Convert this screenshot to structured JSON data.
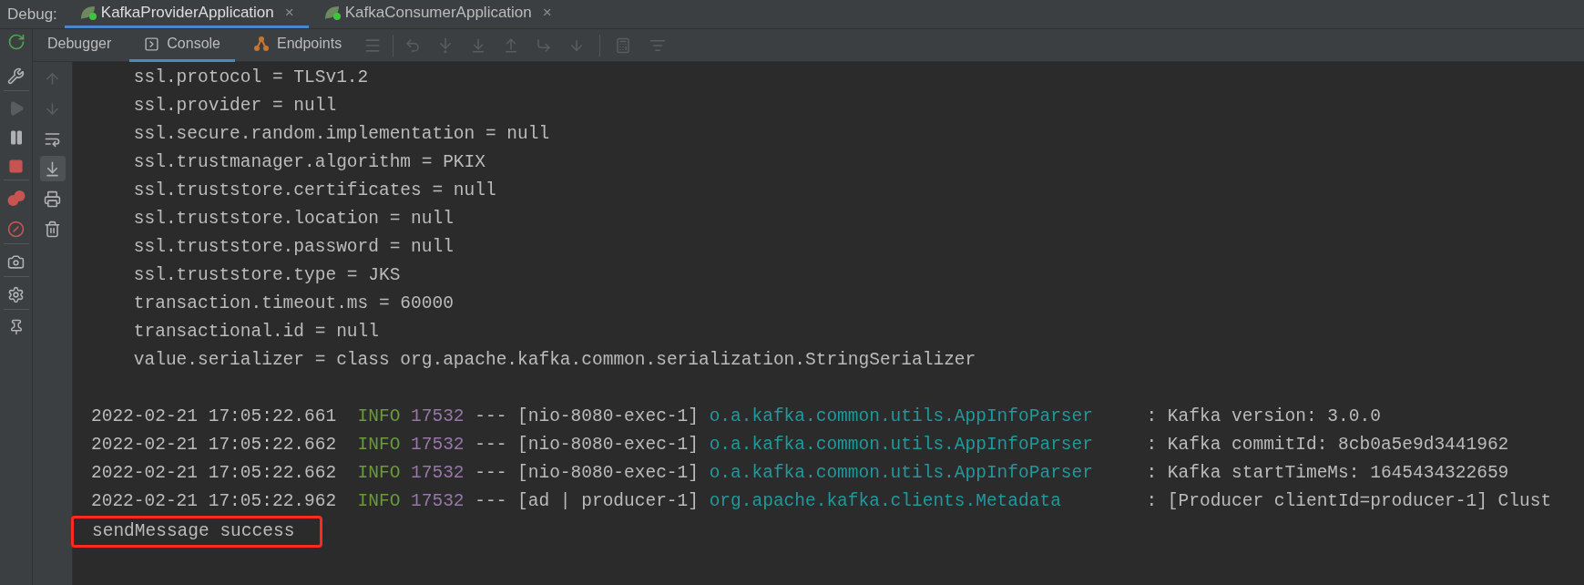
{
  "debug_label": "Debug:",
  "run_tabs": [
    {
      "label": "KafkaProviderApplication",
      "selected": true,
      "close": "×"
    },
    {
      "label": "KafkaConsumerApplication",
      "selected": false,
      "close": "×"
    }
  ],
  "toolbar_tabs": [
    {
      "label": "Debugger",
      "selected": false,
      "kind": "plain"
    },
    {
      "label": "Console",
      "selected": true,
      "kind": "console"
    },
    {
      "label": "Endpoints",
      "selected": false,
      "kind": "endpoints"
    }
  ],
  "scroll_to_end": {
    "on": true
  },
  "config_lines": [
    "ssl.protocol = TLSv1.2",
    "ssl.provider = null",
    "ssl.secure.random.implementation = null",
    "ssl.trustmanager.algorithm = PKIX",
    "ssl.truststore.certificates = null",
    "ssl.truststore.location = null",
    "ssl.truststore.password = null",
    "ssl.truststore.type = JKS",
    "transaction.timeout.ms = 60000",
    "transactional.id = null",
    "value.serializer = class org.apache.kafka.common.serialization.StringSerializer"
  ],
  "log_lines": [
    {
      "timestamp": "2022-02-21 17:05:22.661",
      "level": "INFO",
      "pid": "17532",
      "separator": "---",
      "thread": "[nio-8080-exec-1]",
      "logger": "o.a.kafka.common.utils.AppInfoParser",
      "message": ": Kafka version: 3.0.0"
    },
    {
      "timestamp": "2022-02-21 17:05:22.662",
      "level": "INFO",
      "pid": "17532",
      "separator": "---",
      "thread": "[nio-8080-exec-1]",
      "logger": "o.a.kafka.common.utils.AppInfoParser",
      "message": ": Kafka commitId: 8cb0a5e9d3441962"
    },
    {
      "timestamp": "2022-02-21 17:05:22.662",
      "level": "INFO",
      "pid": "17532",
      "separator": "---",
      "thread": "[nio-8080-exec-1]",
      "logger": "o.a.kafka.common.utils.AppInfoParser",
      "message": ": Kafka startTimeMs: 1645434322659"
    },
    {
      "timestamp": "2022-02-21 17:05:22.962",
      "level": "INFO",
      "pid": "17532",
      "separator": "---",
      "thread": "[ad | producer-1]",
      "logger": "org.apache.kafka.clients.Metadata",
      "message": ": [Producer clientId=producer-1] Clust"
    }
  ],
  "output_line": {
    "text": "sendMessage success",
    "highlighted": true
  }
}
